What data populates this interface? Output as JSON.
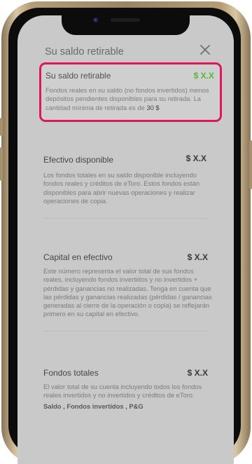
{
  "header": {
    "title": "Su saldo retirable",
    "close_icon": "close-icon"
  },
  "highlight": {
    "title": "Su saldo retirable",
    "value": "$ X.X",
    "description": "Fondos reales en su saldo (no fondos invertidos) menos depósitos pendientes disponibles para su retirada. La cantidad mínima de retirada es de",
    "min_amount": "30 $",
    "border_color": "#e0175b",
    "value_color": "#57b83b"
  },
  "sections": [
    {
      "title": "Efectivo disponible",
      "value": "$ X.X",
      "description": "Los fondos totales en su saldo disponible incluyendo fondos reales y créditos de eToro. Estos fondos están disponibles para abrir nuevas operaciones y realizar operaciones de copia."
    },
    {
      "title": "Capital en efectivo",
      "value": "$ X.X",
      "description": "Este número representa el valor total de sus fondos reales, incluyendo fondos invertidos y no invertidos + pérdidas y ganancias no realizadas. Tenga en cuenta que las pérdidas y ganancias realizadas (pérdidas / ganancias generadas al cierre de la operación o copia) se reflejarán primero en su capital en efectivo."
    },
    {
      "title": "Fondos totales",
      "value": "$ X.X",
      "description": "El valor total de su cuenta incluyendo todos los fondos reales invertidos y no invertidos y créditos de eToro.",
      "components": "Saldo , Fondos invertidos , P&G"
    }
  ]
}
